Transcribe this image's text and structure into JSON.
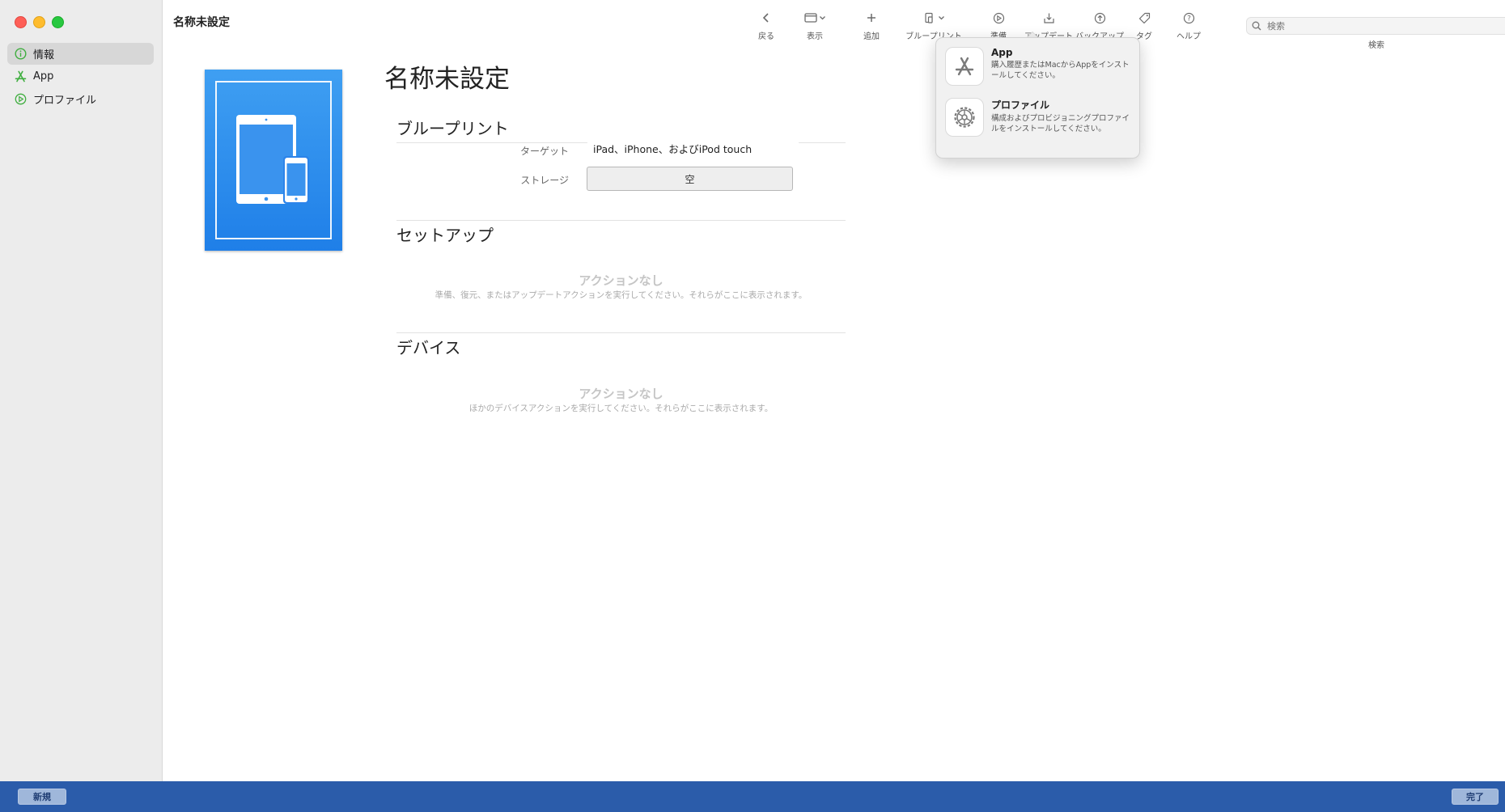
{
  "window": {
    "title": "名称未設定"
  },
  "sidebar": {
    "items": [
      {
        "label": "情報",
        "icon": "info-icon",
        "selected": true
      },
      {
        "label": "App",
        "icon": "app-store-icon"
      },
      {
        "label": "プロファイル",
        "icon": "profile-icon"
      }
    ]
  },
  "toolbar": {
    "items": [
      {
        "label": "戻る",
        "icon": "chevron-left-icon"
      },
      {
        "label": "表示",
        "icon": "window-view-icon"
      },
      {
        "label": "追加",
        "icon": "plus-icon"
      },
      {
        "label": "ブループリント",
        "icon": "blueprint-icon"
      },
      {
        "label": "準備",
        "icon": "prepare-icon"
      },
      {
        "label": "アップデート",
        "icon": "update-icon"
      },
      {
        "label": "バックアップ",
        "icon": "backup-icon"
      },
      {
        "label": "タグ",
        "icon": "tag-icon"
      },
      {
        "label": "ヘルプ",
        "icon": "help-icon"
      }
    ],
    "search": {
      "placeholder": "検索",
      "label": "検索"
    }
  },
  "main": {
    "title": "名称未設定",
    "blueprint": {
      "heading": "ブループリント",
      "target_label": "ターゲット",
      "target_value": "iPad、iPhone、およびiPod touch",
      "storage_label": "ストレージ",
      "storage_value": "空"
    },
    "setup": {
      "heading": "セットアップ",
      "empty_title": "アクションなし",
      "empty_desc": "準備、復元、またはアップデートアクションを実行してください。それらがここに表示されます。"
    },
    "devices": {
      "heading": "デバイス",
      "empty_title": "アクションなし",
      "empty_desc": "ほかのデバイスアクションを実行してください。それらがここに表示されます。"
    }
  },
  "popover": {
    "items": [
      {
        "title": "App",
        "desc": "購入履歴またはMacからAppをインストールしてください。",
        "icon": "app-store-icon"
      },
      {
        "title": "プロファイル",
        "desc": "構成およびプロビジョニングプロファイルをインストールしてください。",
        "icon": "gear-icon"
      }
    ]
  },
  "bottom": {
    "new_label": "新規",
    "done_label": "完了"
  },
  "colors": {
    "accent": "#2b5caa",
    "cover_blue": "#2f8ff0",
    "sidebar_green": "#3fae3f"
  }
}
